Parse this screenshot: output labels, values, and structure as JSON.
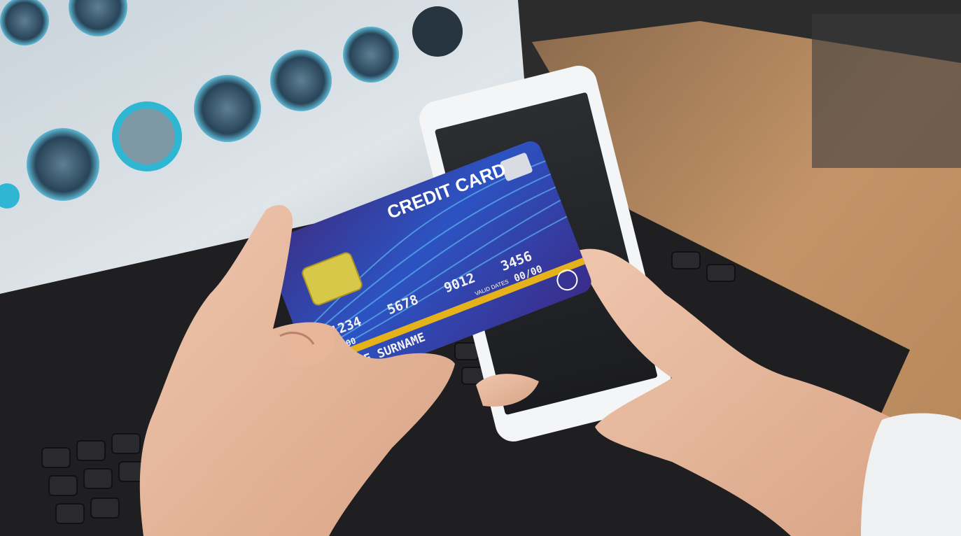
{
  "photo": {
    "card": {
      "title": "CREDIT CARD",
      "number_groups": [
        "1234",
        "5678",
        "9012",
        "3456"
      ],
      "valid_dates_label": "VALID DATES",
      "expiry": "00/00",
      "small_number": "0000",
      "holder_name": "NAME SURNAME"
    },
    "colors": {
      "card_blue": "#2f4db8",
      "card_purple": "#3a2c8a",
      "stripe_gold": "#e6b21c",
      "chip_gold": "#d8c84a",
      "desk_wood": "#b8895a",
      "laptop_black": "#1f1f22"
    }
  }
}
